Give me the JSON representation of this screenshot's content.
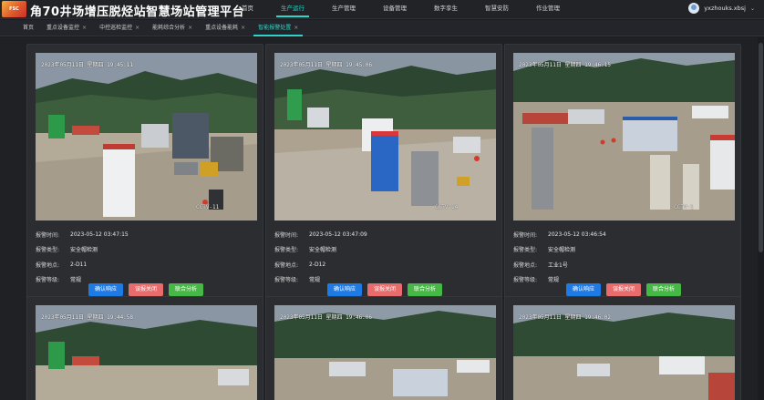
{
  "header": {
    "logo_text": "FSC",
    "title": "角70井场增压脱烃站智慧场站管理平台",
    "nav": [
      "首页",
      "生产运行",
      "生产管理",
      "设备管理",
      "数字孪生",
      "智慧安防",
      "作业管理"
    ],
    "nav_active_index": 1,
    "username": "yxzhouks.xbsj"
  },
  "tabs": [
    {
      "label": "首页",
      "closable": false
    },
    {
      "label": "重点设备监控",
      "closable": true
    },
    {
      "label": "中控巡检监控",
      "closable": true
    },
    {
      "label": "能耗综合分析",
      "closable": true
    },
    {
      "label": "重点设备能耗",
      "closable": true
    },
    {
      "label": "智能报警处置",
      "closable": true,
      "active": true
    }
  ],
  "labels": {
    "time": "报警时间:",
    "type": "报警类型:",
    "location": "报警地点:",
    "level": "报警等级:"
  },
  "buttons": {
    "confirm": "确认响应",
    "false_alarm": "误报关闭",
    "joint": "联合分析"
  },
  "alarms": [
    {
      "stamp": "2023年05月11日 星期四 19:45:11",
      "cctv": "CCTV-11",
      "time": "2023-05-12 03:47:15",
      "type": "安全帽检测",
      "location": "2-D11",
      "level": "常规"
    },
    {
      "stamp": "2023年05月11日 星期四 19:45:06",
      "cctv": "CCTV-14",
      "time": "2023-05-12 03:47:09",
      "type": "安全帽检测",
      "location": "2-D12",
      "level": "常规"
    },
    {
      "stamp": "2023年05月11日 星期四 19:46:15",
      "cctv": "CCTV-1",
      "time": "2023-05-12 03:46:54",
      "type": "安全帽检测",
      "location": "工业1号",
      "level": "常规"
    },
    {
      "stamp": "2023年05月11日 星期四 19:44:58",
      "cctv": "",
      "time": "",
      "type": "",
      "location": "",
      "level": ""
    },
    {
      "stamp": "2023年05月11日 星期四 19:46:06",
      "cctv": "",
      "time": "",
      "type": "",
      "location": "",
      "level": ""
    },
    {
      "stamp": "2023年05月11日 星期四 19:46:02",
      "cctv": "",
      "time": "",
      "type": "",
      "location": "",
      "level": ""
    }
  ],
  "colors": {
    "accent": "#2fd3c8",
    "btn_confirm": "#1e7be6",
    "btn_false": "#e86c6c",
    "btn_joint": "#45b845"
  }
}
